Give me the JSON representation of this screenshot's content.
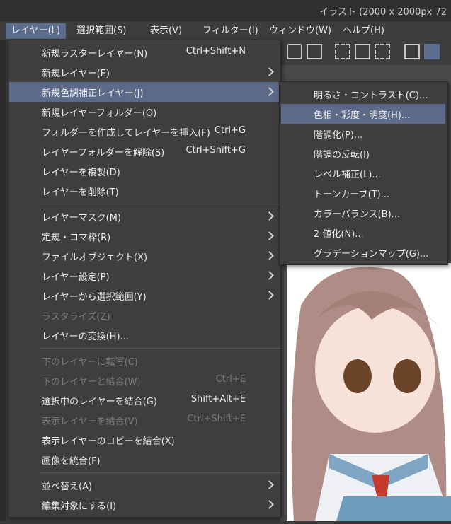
{
  "titlebar": {
    "title": "イラスト (2000 x 2000px 72"
  },
  "menubar": {
    "items": [
      {
        "label": "レイヤー(L)"
      },
      {
        "label": "選択範囲(S)"
      },
      {
        "label": "表示(V)"
      },
      {
        "label": "フィルター(I)"
      },
      {
        "label": "ウィンドウ(W)"
      },
      {
        "label": "ヘルプ(H)"
      }
    ]
  },
  "layer_menu": {
    "items": [
      {
        "label": "新規ラスターレイヤー(N)",
        "shortcut": "Ctrl+Shift+N"
      },
      {
        "label": "新規レイヤー(E)"
      },
      {
        "label": "新規色調補正レイヤー(J)"
      },
      {
        "label": "新規レイヤーフォルダー(O)"
      },
      {
        "label": "フォルダーを作成してレイヤーを挿入(F)",
        "shortcut": "Ctrl+G"
      },
      {
        "label": "レイヤーフォルダーを解除(S)",
        "shortcut": "Ctrl+Shift+G"
      },
      {
        "label": "レイヤーを複製(D)"
      },
      {
        "label": "レイヤーを削除(T)"
      },
      {
        "label": "レイヤーマスク(M)"
      },
      {
        "label": "定規・コマ枠(R)"
      },
      {
        "label": "ファイルオブジェクト(X)"
      },
      {
        "label": "レイヤー設定(P)"
      },
      {
        "label": "レイヤーから選択範囲(Y)"
      },
      {
        "label": "ラスタライズ(Z)"
      },
      {
        "label": "レイヤーの変換(H)..."
      },
      {
        "label": "下のレイヤーに転写(C)"
      },
      {
        "label": "下のレイヤーと結合(W)",
        "shortcut": "Ctrl+E"
      },
      {
        "label": "選択中のレイヤーを結合(G)",
        "shortcut": "Shift+Alt+E"
      },
      {
        "label": "表示レイヤーを結合(V)",
        "shortcut": "Ctrl+Shift+E"
      },
      {
        "label": "表示レイヤーのコピーを結合(X)"
      },
      {
        "label": "画像を統合(F)"
      },
      {
        "label": "並べ替え(A)"
      },
      {
        "label": "編集対象にする(I)"
      }
    ]
  },
  "color_correction_submenu": {
    "items": [
      {
        "label": "明るさ・コントラスト(C)..."
      },
      {
        "label": "色相・彩度・明度(H)..."
      },
      {
        "label": "階調化(P)..."
      },
      {
        "label": "階調の反転(I)"
      },
      {
        "label": "レベル補正(L)..."
      },
      {
        "label": "トーンカーブ(T)..."
      },
      {
        "label": "カラーバランス(B)..."
      },
      {
        "label": "2 値化(N)..."
      },
      {
        "label": "グラデーションマップ(G)..."
      }
    ]
  },
  "colors": {
    "highlight": "#5b6a89",
    "menu_bg": "#3e3e3e",
    "disabled_text": "#7c7c7c"
  }
}
